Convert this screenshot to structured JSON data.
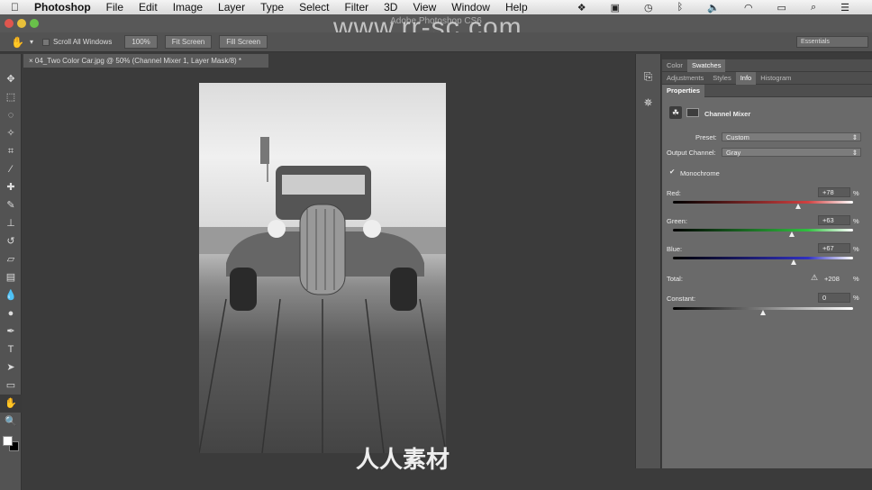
{
  "menubar": {
    "app": "Photoshop",
    "items": [
      "File",
      "Edit",
      "Image",
      "Layer",
      "Type",
      "Select",
      "Filter",
      "3D",
      "View",
      "Window",
      "Help"
    ]
  },
  "title": "Adobe Photoshop CS6",
  "watermark": {
    "url": "www.rr-sc.com",
    "brand": "人人素材"
  },
  "options": {
    "scroll_all": "Scroll All Windows",
    "zoom100": "100%",
    "fit_screen": "Fit Screen",
    "fill_screen": "Fill Screen",
    "workspace": "Essentials"
  },
  "document_tab": "04_Two Color Car.jpg @ 50% (Channel Mixer 1, Layer Mask/8) *",
  "panels": {
    "row1": [
      "Color",
      "Swatches"
    ],
    "row2": [
      "Adjustments",
      "Styles",
      "Info",
      "Histogram"
    ],
    "row3": [
      "Properties"
    ]
  },
  "properties": {
    "title": "Channel Mixer",
    "preset_label": "Preset:",
    "preset": "Custom",
    "output_label": "Output Channel:",
    "output": "Gray",
    "monochrome": "Monochrome",
    "monochrome_checked": true,
    "sliders": [
      {
        "label": "Red:",
        "value": "+78",
        "pct": 78,
        "color": "#d04040"
      },
      {
        "label": "Green:",
        "value": "+63",
        "pct": 63,
        "color": "#30c040"
      },
      {
        "label": "Blue:",
        "value": "+67",
        "pct": 67,
        "color": "#3030c0"
      }
    ],
    "total_label": "Total:",
    "total": "+208",
    "constant_label": "Constant:",
    "constant": "0",
    "unit": "%"
  }
}
